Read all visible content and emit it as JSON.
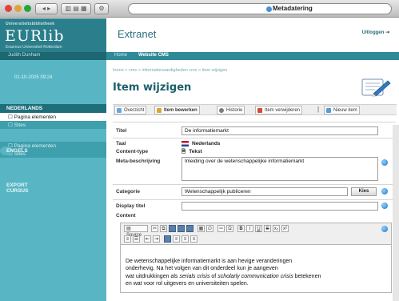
{
  "window": {
    "title": "Metadatering",
    "nav_back": "◂",
    "nav_fwd": "▸"
  },
  "header": {
    "org_line": "Universiteitsbibliotheek",
    "logo": "EURlib",
    "org_foot": "Erasmus Universiteit Rotterdam",
    "app_title": "Extranet",
    "logout_label": "Uitloggen"
  },
  "userbar": {
    "user": "Judith Dunham",
    "date": "01-10-2005 09:24"
  },
  "nav": {
    "home": "Home",
    "site": "Website CMS"
  },
  "sidebar": {
    "sections": [
      {
        "title": "NEDERLANDS",
        "items": [
          "Pagina elementen",
          "Sites"
        ]
      },
      {
        "title": "ENGELS",
        "items": [
          "Pagina elementen",
          "Sites"
        ]
      },
      {
        "title": "EXPORT CURSUS",
        "items": []
      }
    ]
  },
  "breadcrumb": "home > cms > informatievaardigheden cms > item wijzigen",
  "page_title": "Item wijzigen",
  "actions": [
    {
      "label": "Overzicht",
      "bold": false
    },
    {
      "label": "Item bewerken",
      "bold": true
    },
    {
      "label": "Historie",
      "bold": false
    },
    {
      "label": "Item verwijderen",
      "bold": false
    },
    {
      "label": "Nieuw item",
      "bold": false
    }
  ],
  "form": {
    "titel_label": "Titel",
    "titel_value": "De informatiemarkt",
    "taal_label": "Taal",
    "taal_value": "Nederlands",
    "ctype_label": "Content-type",
    "ctype_value": "Tekst",
    "meta_label": "Meta-beschrijving",
    "meta_value": "Inleiding over de wetenschappelijke informatiemarkt",
    "cat_label": "Categorie",
    "cat_value": "Wetenschappelijk publiceren",
    "cat_button": "Kies",
    "display_label": "Display titel",
    "display_value": "",
    "content_label": "Content"
  },
  "editor": {
    "source_label": "Source",
    "body_line1": "De wetenschappelijke informatiemarkt is aan hevige veranderingen",
    "body_line2": "onderhevig. Na het volgen van dit onderdeel kun je aangeven",
    "body_line3_a": "wat uitdrukkingen als ",
    "body_line3_em1": "serials crisis",
    "body_line3_b": " of ",
    "body_line3_em2": "scholarly communication crisis",
    "body_line3_c": " betekenen",
    "body_line4": "en wat voor rol uitgevers en universiteiten spelen."
  },
  "colors": {
    "teal_dark": "#1f6f7b",
    "teal_light": "#58b6c4",
    "accent": "#2b7e8b"
  }
}
